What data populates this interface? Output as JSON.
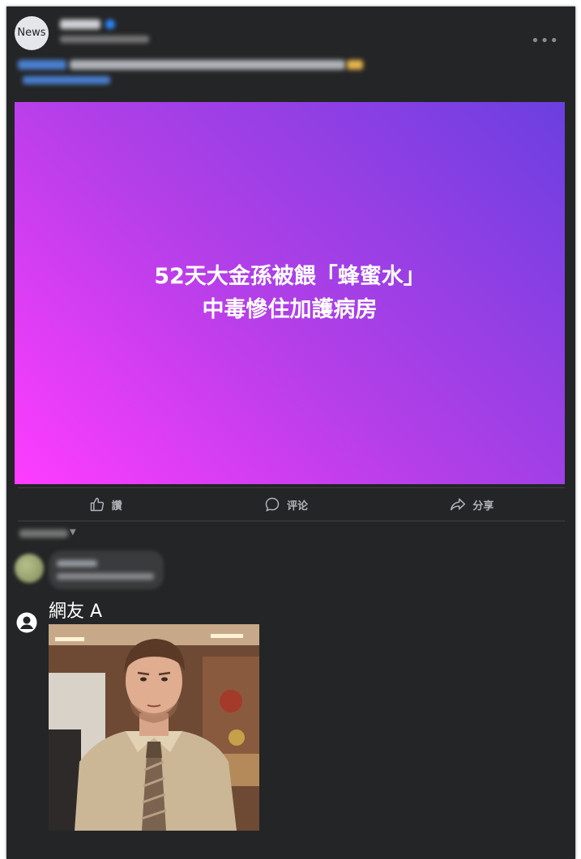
{
  "post": {
    "avatar_text": "News",
    "banner": {
      "line1": "52天大金孫被餵「蜂蜜水」",
      "line2": "中毒慘住加護病房"
    }
  },
  "actions": {
    "like": "讚",
    "comment": "评论",
    "share": "分享"
  },
  "reply": {
    "user": "網友 A"
  },
  "colors": {
    "card_bg": "#242526",
    "gradient_start": "#ff3cff",
    "gradient_end": "#6b3fe0",
    "action_text": "#b0b3b8"
  }
}
